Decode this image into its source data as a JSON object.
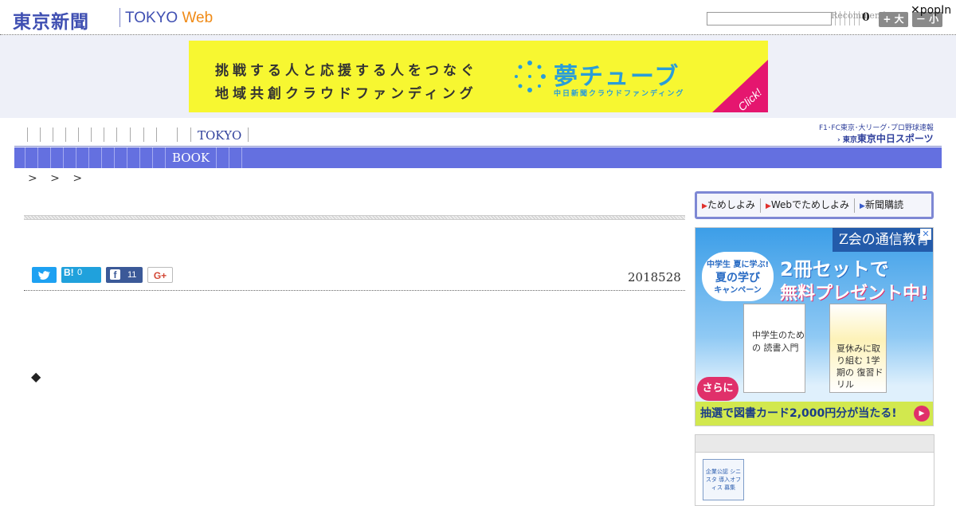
{
  "header": {
    "logo_jp": "東京新聞",
    "logo_tokyo": "TOKYO",
    "logo_web": "Web",
    "recommend": "Recommend",
    "count": "0",
    "large_label": "+ 大",
    "small_label": "－ 小",
    "popin_close": "✕popIn",
    "search_placeholder": ""
  },
  "ad_banner": {
    "line1": "挑戦する人と応援する人をつなぐ",
    "line2": "地域共創クラウドファンディング",
    "brand": "夢チューブ",
    "brand_sub": "中日新聞クラウドファンディング",
    "click": "Click!"
  },
  "nav": {
    "tokyo_label": "TOKYO",
    "book_label": "BOOK",
    "chunichi_top": "F1･FC東京･大リーグ･プロ野球速報",
    "chunichi_logo": "東京中日スポーツ",
    "chunichi_prefix": "› 東京"
  },
  "breadcrumb": ">  > >",
  "article": {
    "date": "2018528",
    "diamond": "◆",
    "share": {
      "twitter_icon": "twitter-icon",
      "hatena_label": "B!",
      "hatena_count": "0",
      "facebook_label": "f",
      "facebook_count": "11",
      "gplus_label": "G+"
    }
  },
  "subscribe": {
    "links": [
      "ためしよみ",
      "Webでためしよみ",
      "新聞購読"
    ]
  },
  "side_ad": {
    "corner": "Z会の通信教育",
    "badge_line1": "中学生 夏に学ぶ!",
    "badge_line2": "夏の学び",
    "badge_line3": "キャンペーン",
    "headline1": "2冊セットで",
    "headline2": "無料プレゼント中!",
    "book_left": "中学生のための 読書入門",
    "book_right": "夏休みに取り組む 1学期の 復習ドリル",
    "sarani": "さらに",
    "bottom": "抽選で図書カード2,000円分が当たる!",
    "close": "✕"
  },
  "side_panel": {
    "badge": "企業公認 シニスタ 導入オフィス 募集"
  },
  "colors": {
    "brand_blue": "#3f4fb2",
    "nav_bar": "#6470e0",
    "ad_yellow": "#f7f731",
    "twitter": "#1da1f2",
    "facebook": "#3b5998"
  }
}
